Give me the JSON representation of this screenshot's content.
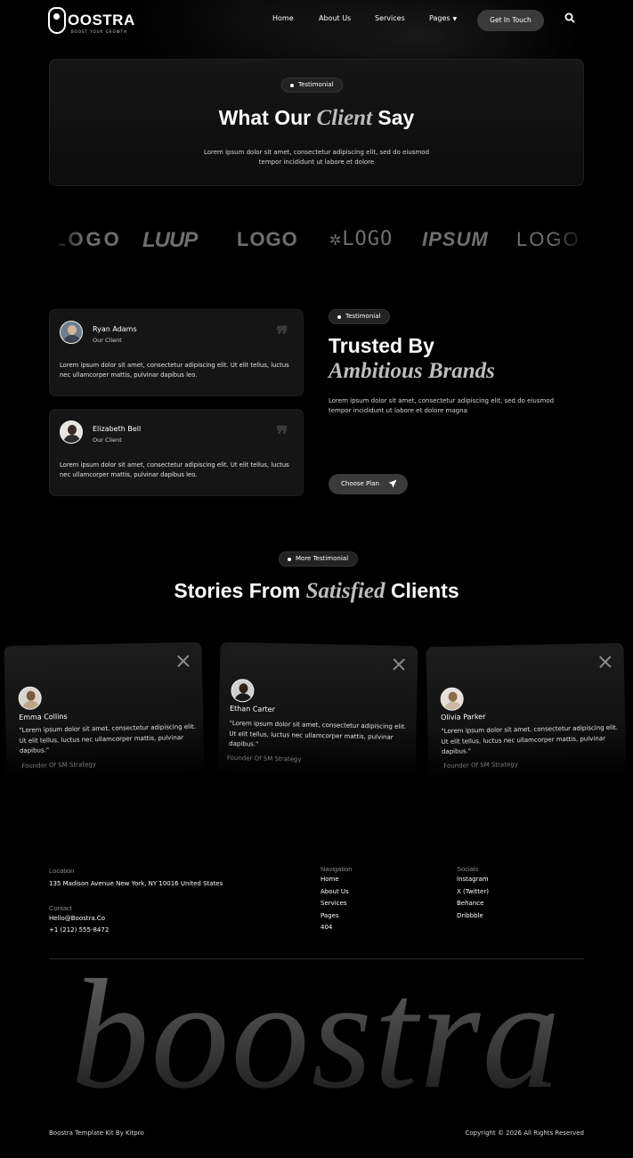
{
  "nav": {
    "logo_text": "OOSTRA",
    "logo_tagline": "BOOST YOUR GROWTH",
    "links": [
      "Home",
      "About Us",
      "Services",
      "Pages"
    ],
    "cta": "Get In Touch"
  },
  "hero": {
    "pill": "Testimonial",
    "title_pre": "What Our",
    "title_italic": "Client",
    "title_post": "Say",
    "desc_line1": "Lorem ipsum dolor sit amet, consectetur adipiscing elit, sed do eiusmod",
    "desc_line2": "tempor incididunt ut labore et dolore"
  },
  "brands": [
    "LOGO",
    "LUUP",
    "LOGO",
    "LOGO",
    "IPSUM",
    "LOGO"
  ],
  "testimonials": [
    {
      "name": "Ryan Adams",
      "role": "Our Client",
      "text": "Lorem ipsum dolor sit amet, consectetur adipiscing elit. Ut elit tellus, luctus nec ullamcorper mattis, pulvinar dapibus leo."
    },
    {
      "name": "Elizabeth Bell",
      "role": "Our Client",
      "text": "Lorem ipsum dolor sit amet, consectetur adipiscing elit. Ut elit tellus, luctus nec ullamcorper mattis, pulvinar dapibus leo."
    }
  ],
  "trusted": {
    "pill": "Testimonial",
    "title_line1": "Trusted By",
    "title_line2": "Ambitious Brands",
    "desc": "Lorem ipsum dolor sit amet, consectetur adipiscing elit, sed do eiusmod tempor incididunt ut labore et dolore magna",
    "button": "Choose Plan"
  },
  "stories": {
    "pill": "More Testimonial",
    "title_pre": "Stories From",
    "title_italic": "Satisfied",
    "title_post": "Clients",
    "cards": [
      {
        "name": "Emma Collins",
        "text": "\"Lorem ipsum dolor sit amet, consectetur adipiscing elit. Ut elit tellus, luctus nec ullamcorper mattis, pulvinar dapibus.\"",
        "role": "Founder Of SM Strategy"
      },
      {
        "name": "Ethan Carter",
        "text": "\"Lorem ipsum dolor sit amet, consectetur adipiscing elit. Ut elit tellus, luctus nec ullamcorper mattis, pulvinar dapibus.\"",
        "role": "Founder Of SM Strategy"
      },
      {
        "name": "Olivia Parker",
        "text": "\"Lorem ipsum dolor sit amet, consectetur adipiscing elit. Ut elit tellus, luctus nec ullamcorper mattis, pulvinar dapibus.\"",
        "role": "Founder Of SM Strategy"
      }
    ]
  },
  "footer": {
    "location_label": "Location",
    "location": "135 Madison Avenue New York, NY 10016 United States",
    "contact_label": "Contact",
    "email": "Hello@Boostra.Co",
    "phone": "+1 (212) 555-8472",
    "nav_label": "Navigation",
    "nav_links": [
      "Home",
      "About Us",
      "Services",
      "Pages",
      "404"
    ],
    "socials_label": "Socials",
    "socials": [
      "Instagram",
      "X (Twitter)",
      "Behance",
      "Dribbble"
    ],
    "big_word": "boostra",
    "credit": "Boostra Template Kit By Kitpro",
    "copyright": "Copyright © 2026 All Rights Reserved"
  }
}
